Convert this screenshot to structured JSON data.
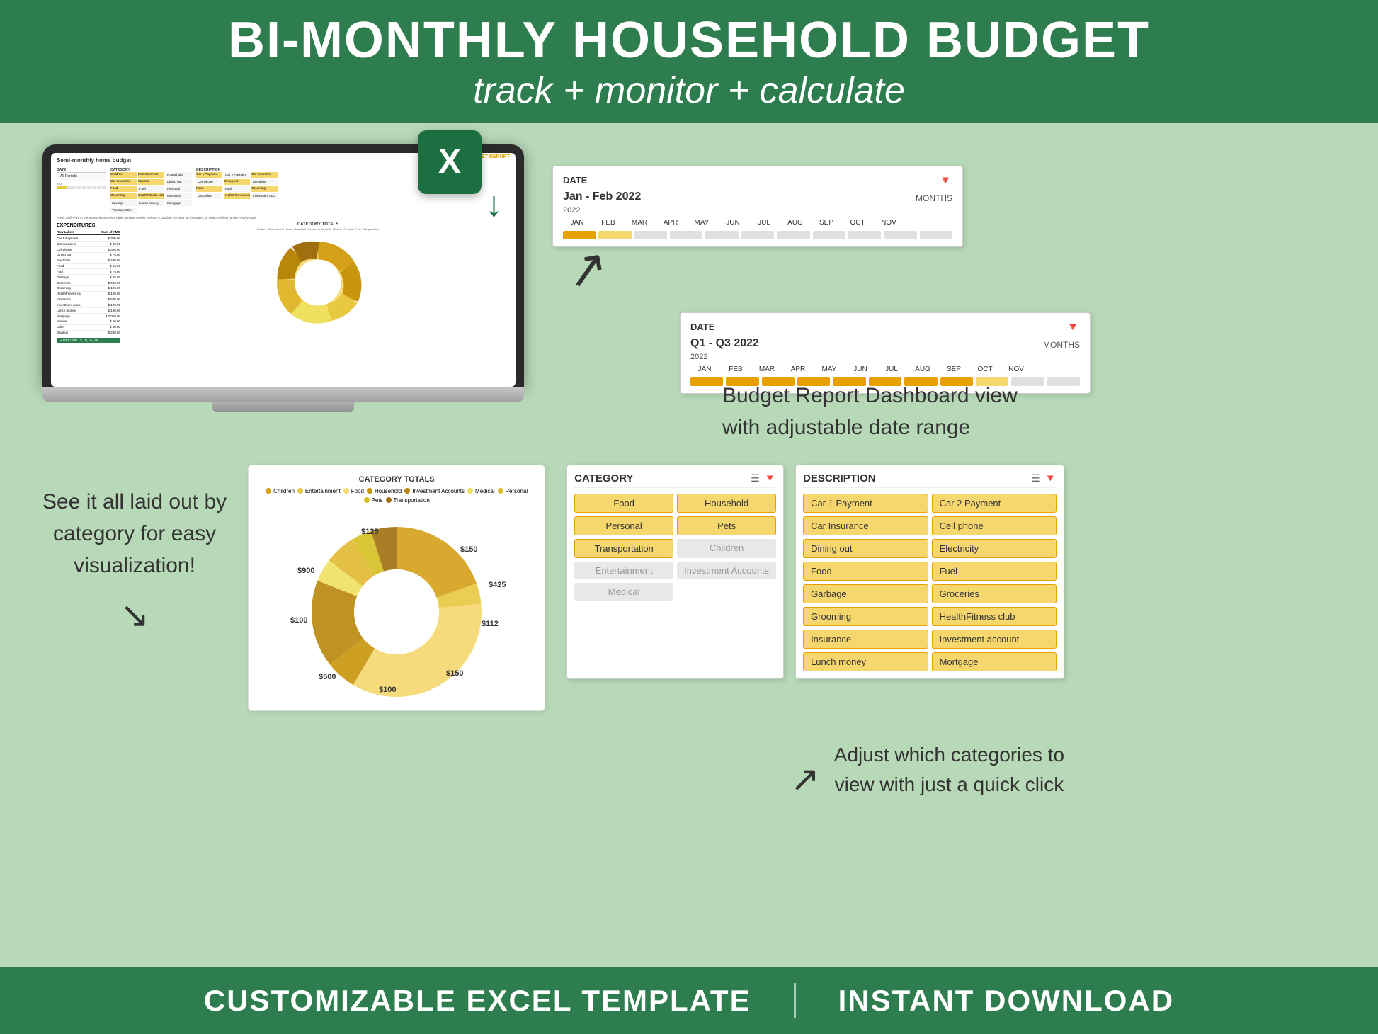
{
  "header": {
    "title": "BI-MONTHLY HOUSEHOLD BUDGET",
    "subtitle": "track + monitor + calculate"
  },
  "laptop": {
    "spreadsheet_title": "Semi-monthly home budget",
    "budget_report_label": "BUDGET REPORT",
    "date_label": "DATE",
    "category_label": "CATEGORY",
    "description_label": "DESCRIPTION",
    "instructions": "Press Shift+F10 in the Expenditures PivotTable and then select Refresh to update the data on this sheet, or select Refresh under Analyze tab.",
    "expenditures_title": "EXPENDITURES",
    "chart_title": "CATEGORY TOTALS",
    "row_labels": [
      "Car 1 Payment",
      "Car Insurance",
      "Cell phone",
      "Dining out",
      "Electricity",
      "Food",
      "Fuel",
      "Garbage",
      "Groceries",
      "Grooming",
      "HealthFitness clu",
      "Insurance",
      "Investment accu.",
      "Lunch money",
      "Mortgage",
      "Movies",
      "Other",
      "Savings",
      "Grand Total"
    ],
    "amounts": [
      "300.00",
      "50.00",
      "395.00",
      "75.00",
      "400.00",
      "50.00",
      "75.00",
      "75.00",
      "900.00",
      "100.00",
      "100.00",
      "500.00",
      "100.00",
      "100.00",
      "7,000.00",
      "10.00",
      "50.00",
      "250.00",
      "10,742.00"
    ]
  },
  "date_panel_1": {
    "label": "DATE",
    "range": "Jan - Feb 2022",
    "year": "2022",
    "months_label": "MONTHS",
    "months": [
      "JAN",
      "FEB",
      "MAR",
      "APR",
      "MAY",
      "JUN",
      "JUL",
      "AUG",
      "SEP",
      "OCT",
      "NOV"
    ],
    "active_months": [
      0,
      1
    ]
  },
  "date_panel_2": {
    "label": "DATE",
    "range": "Q1 - Q3 2022",
    "year": "2022",
    "months_label": "MONTHS",
    "months": [
      "JAN",
      "FEB",
      "MAR",
      "APR",
      "MAY",
      "JUN",
      "JUL",
      "AUG",
      "SEP",
      "OCT",
      "NOV"
    ],
    "active_months": [
      0,
      1,
      2,
      3,
      4,
      5,
      6,
      7,
      8
    ]
  },
  "budget_desc": "Budget Report Dashboard view\nwith adjustable date range",
  "left_category_text": "See it all laid out by\ncategory for easy\nvisualization!",
  "right_adjust_text": "Adjust which categories to\nview with just a quick click",
  "category_panel": {
    "title": "CATEGORY",
    "items_active": [
      "Food",
      "Personal",
      "Transportation",
      "Household",
      "Pets"
    ],
    "items_inactive": [
      "Entertainment",
      "Children",
      "Medical",
      "Investment Accounts"
    ]
  },
  "description_panel": {
    "title": "DESCRIPTION",
    "items_active": [
      "Car 1 Payment",
      "Car 2 Payment",
      "Car Insurance",
      "Cell phone",
      "Dining out",
      "Electricity",
      "Food",
      "Fuel",
      "Garbage",
      "Groceries",
      "Grooming",
      "HealthFitness club",
      "Insurance",
      "Investment account",
      "Lunch money",
      "Mortgage"
    ],
    "items_inactive": []
  },
  "donut_chart": {
    "title": "CATEGORY TOTALS",
    "legend": [
      "Children",
      "Entertainment",
      "Food",
      "Household",
      "Investment Accounts",
      "Medical",
      "Personal",
      "Pets",
      "Transportation"
    ],
    "legend_colors": [
      "#d4a017",
      "#e8c840",
      "#f5d76e",
      "#c8960c",
      "#b8860b",
      "#f0e060",
      "#e0b830",
      "#d4c020",
      "#a07010"
    ],
    "values": [
      500,
      100,
      900,
      150,
      425,
      112,
      150,
      100,
      125
    ],
    "labels": [
      "$500",
      "$100",
      "$900",
      "$150",
      "$425",
      "$112",
      "$150",
      "$100",
      "$125"
    ]
  },
  "footer": {
    "left_text": "CUSTOMIZABLE EXCEL TEMPLATE",
    "right_text": "INSTANT DOWNLOAD"
  }
}
